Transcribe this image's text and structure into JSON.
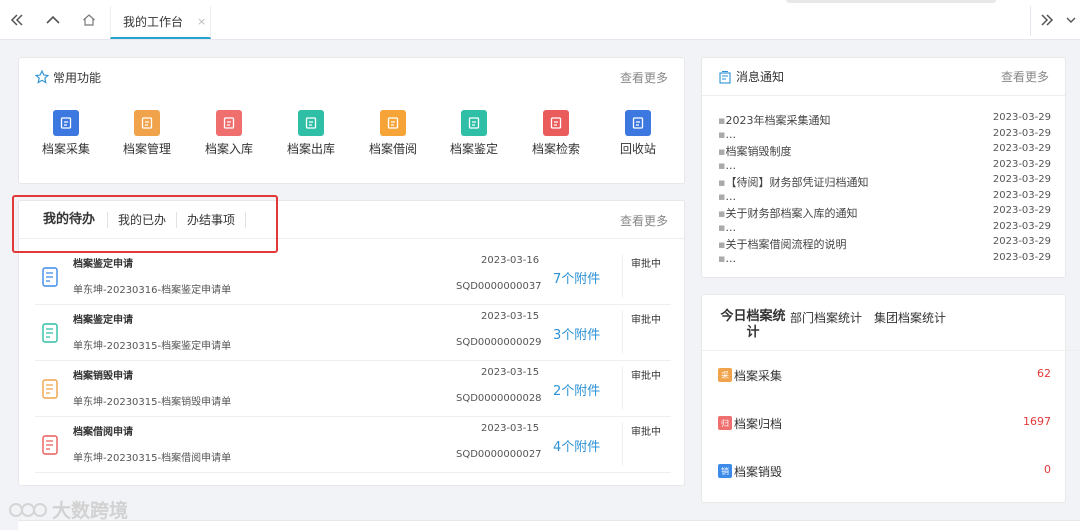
{
  "topbar": {
    "tab_label": "我的工作台",
    "tab_close": "×"
  },
  "functions": {
    "title": "常用功能",
    "more": "查看更多",
    "items": [
      {
        "label": "档案采集",
        "color": "#3d78e0",
        "icon": "collect-icon"
      },
      {
        "label": "档案管理",
        "color": "#f0a34a",
        "icon": "manage-icon"
      },
      {
        "label": "档案入库",
        "color": "#ef6f6f",
        "icon": "inbound-icon"
      },
      {
        "label": "档案出库",
        "color": "#2ebfa6",
        "icon": "outbound-icon"
      },
      {
        "label": "档案借阅",
        "color": "#f6a437",
        "icon": "borrow-icon"
      },
      {
        "label": "档案鉴定",
        "color": "#2ebfa6",
        "icon": "appraise-icon"
      },
      {
        "label": "档案检索",
        "color": "#ea5c5c",
        "icon": "search-icon"
      },
      {
        "label": "回收站",
        "color": "#3d78e0",
        "icon": "recycle-icon"
      }
    ]
  },
  "todo": {
    "tabs": [
      "我的待办",
      "我的已办",
      "办结事项"
    ],
    "more": "查看更多",
    "rows": [
      {
        "title": "档案鉴定申请",
        "sub": "单东坤-20230316-档案鉴定申请单",
        "date": "2023-03-16",
        "code": "SQD0000000037",
        "attach": "7个附件",
        "status": "审批中",
        "icon": "appraise-doc-icon",
        "color": "#3d8be8"
      },
      {
        "title": "档案鉴定申请",
        "sub": "单东坤-20230315-档案鉴定申请单",
        "date": "2023-03-15",
        "code": "SQD0000000029",
        "attach": "3个附件",
        "status": "审批中",
        "icon": "checklist-doc-icon",
        "color": "#2ebfa6"
      },
      {
        "title": "档案销毁申请",
        "sub": "单东坤-20230315-档案销毁申请单",
        "date": "2023-03-15",
        "code": "SQD0000000028",
        "attach": "2个附件",
        "status": "审批中",
        "icon": "open-book-icon",
        "color": "#f0a34a"
      },
      {
        "title": "档案借阅申请",
        "sub": "单东坤-20230315-档案借阅申请单",
        "date": "2023-03-15",
        "code": "SQD0000000027",
        "attach": "4个附件",
        "status": "审批中",
        "icon": "borrow-doc-icon",
        "color": "#ea5c5c"
      }
    ]
  },
  "notices": {
    "title": "消息通知",
    "more": "查看更多",
    "items": [
      {
        "text": "2023年档案采集通知",
        "date": "2023-03-29"
      },
      {
        "text": "...",
        "date": "2023-03-29"
      },
      {
        "text": "档案销毁制度",
        "date": "2023-03-29"
      },
      {
        "text": "...",
        "date": "2023-03-29"
      },
      {
        "text": "【待阅】财务部凭证归档通知",
        "date": "2023-03-29"
      },
      {
        "text": "...",
        "date": "2023-03-29"
      },
      {
        "text": "关于财务部档案入库的通知",
        "date": "2023-03-29"
      },
      {
        "text": "...",
        "date": "2023-03-29"
      },
      {
        "text": "关于档案借阅流程的说明",
        "date": "2023-03-29"
      },
      {
        "text": "...",
        "date": "2023-03-29"
      }
    ]
  },
  "stats": {
    "tabs": [
      "今日档案统计",
      "部门档案统计",
      "集团档案统计"
    ],
    "rows": [
      {
        "label": "档案采集",
        "value": "62",
        "badge": "采",
        "color": "#f0a34a"
      },
      {
        "label": "档案归档",
        "value": "1697",
        "badge": "归",
        "color": "#ef6f6f"
      },
      {
        "label": "档案销毁",
        "value": "0",
        "badge": "销",
        "color": "#3d8be8"
      }
    ]
  },
  "watermark": "大数跨境"
}
